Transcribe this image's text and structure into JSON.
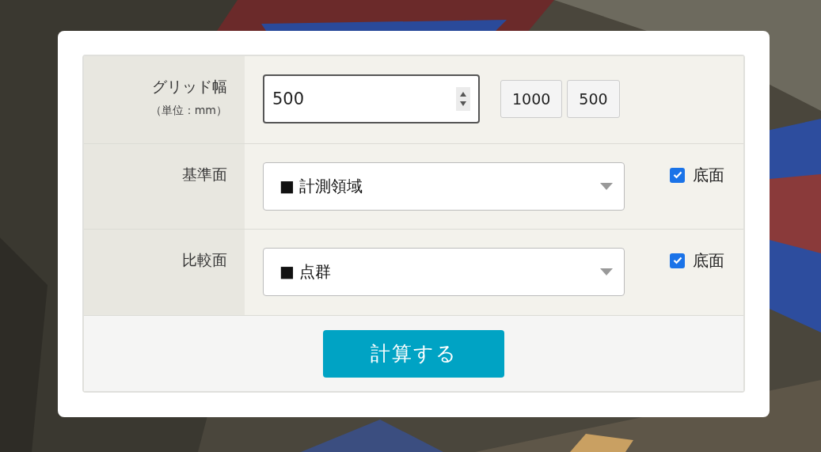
{
  "form": {
    "rows": [
      {
        "kind": "number",
        "label": "グリッド幅",
        "unit": "（単位：mm）",
        "value": "500",
        "presets": [
          "1000",
          "500"
        ]
      },
      {
        "kind": "select",
        "label": "基準面",
        "value": "■ 計測領域",
        "checkbox": {
          "label": "底面",
          "checked": true
        }
      },
      {
        "kind": "select",
        "label": "比較面",
        "value": "■ 点群",
        "checkbox": {
          "label": "底面",
          "checked": true
        }
      }
    ],
    "submit": "計算する"
  }
}
